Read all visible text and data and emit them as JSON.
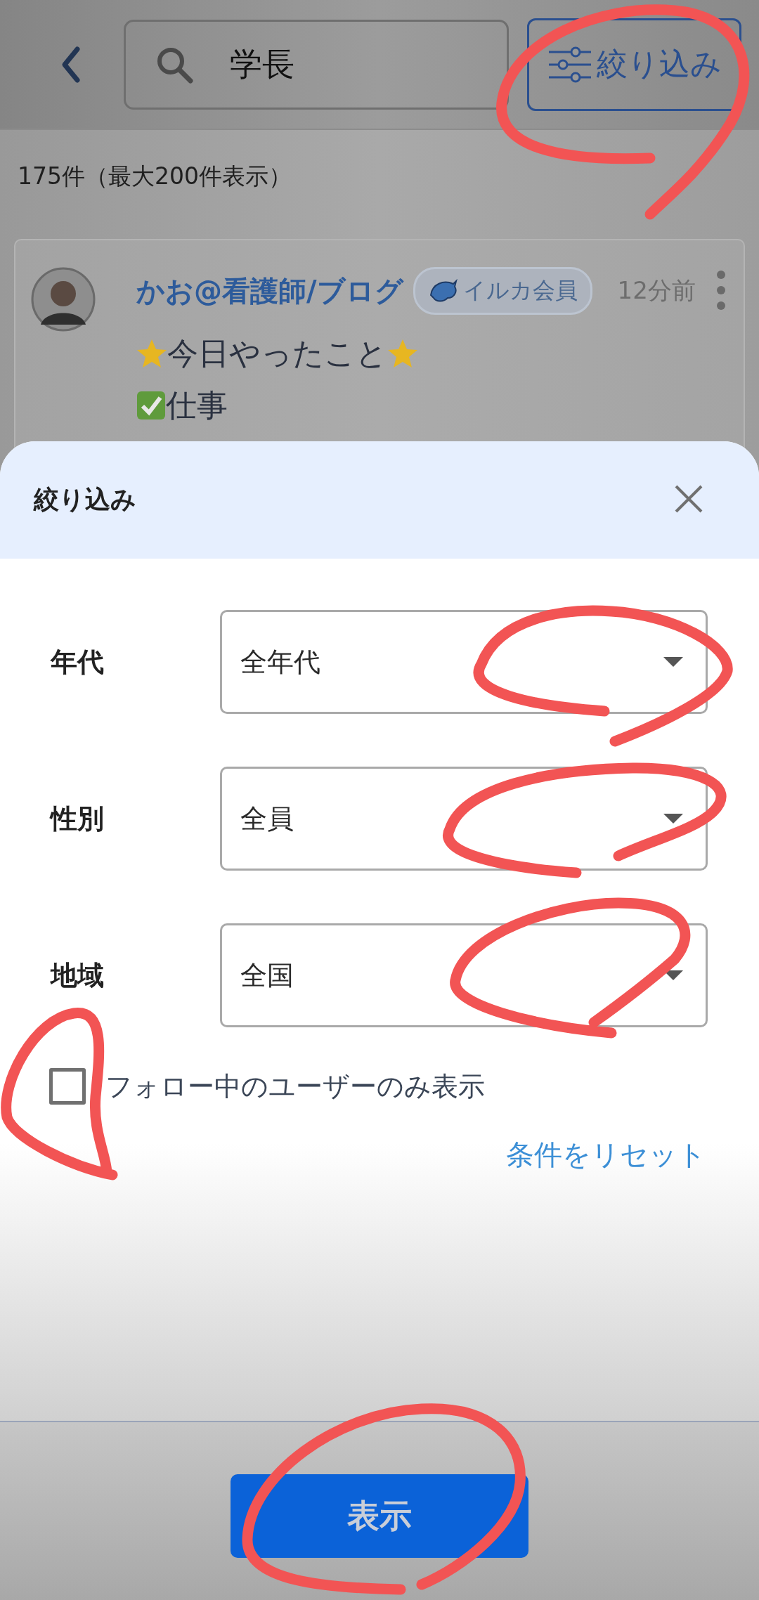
{
  "search_bar": {
    "value": "学長",
    "filter_button": "絞り込み"
  },
  "result_count": "175件（最大200件表示）",
  "post": {
    "author": "かお@看護師/ブログ",
    "badge": "イルカ会員",
    "time": "12分前",
    "lines": [
      {
        "kind": "starred",
        "text": "今日やったこと"
      },
      {
        "kind": "checked",
        "text": "仕事"
      }
    ]
  },
  "filter_sheet": {
    "title": "絞り込み",
    "fields": [
      {
        "label": "年代",
        "value": "全年代"
      },
      {
        "label": "性別",
        "value": "全員"
      },
      {
        "label": "地域",
        "value": "全国"
      }
    ],
    "follow_only": {
      "label": "フォロー中のユーザーのみ表示",
      "checked": false
    },
    "reset_link": "条件をリセット",
    "submit_button": "表示"
  }
}
